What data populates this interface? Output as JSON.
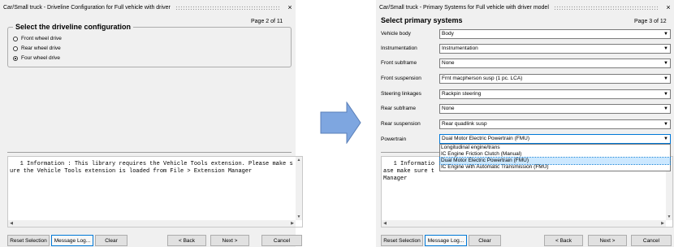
{
  "left_dialog": {
    "title": "Car/Small truck - Driveline Configuration for Full vehicle with driver",
    "page": "Page  2 of 11",
    "group_title": "Select the driveline configuration",
    "options": [
      {
        "label": "Front wheel drive",
        "selected": false
      },
      {
        "label": "Rear wheel drive",
        "selected": false
      },
      {
        "label": "Four wheel drive",
        "selected": true
      }
    ],
    "log_text": "   1 Information : This library requires the Vehicle Tools extension. Please make sure the Vehicle Tools extension is loaded from File > Extension Manager",
    "buttons": {
      "reset": "Reset Selection",
      "message_log": "Message Log...",
      "clear": "Clear",
      "back": "< Back",
      "next": "Next >",
      "cancel": "Cancel"
    }
  },
  "right_dialog": {
    "title": "Car/Small truck - Primary Systems for Full vehicle with driver model",
    "heading": "Select primary systems",
    "page": "Page  3 of 12",
    "rows": [
      {
        "label": "Vehicle body",
        "value": "Body"
      },
      {
        "label": "Instrumentation",
        "value": "Instrumentation"
      },
      {
        "label": "Front subframe",
        "value": "None"
      },
      {
        "label": "Front suspension",
        "value": "Frnt macpherson susp (1 pc. LCA)"
      },
      {
        "label": "Steering linkages",
        "value": "Rackpin steering"
      },
      {
        "label": "Rear subframe",
        "value": "None"
      },
      {
        "label": "Rear suspension",
        "value": "Rear quadlink susp"
      },
      {
        "label": "Powertrain",
        "value": "Dual Motor Electric Powertrain (FMU)"
      }
    ],
    "powertrain_options": [
      "Longitudinal engine/trans",
      "IC Engine Friction Clutch (Manual)",
      "Dual Motor Electric Powertrain (FMU)",
      "IC Engine with Automatic Transmission (FMU)"
    ],
    "log_text_visible": "   1 Informatio\nase make sure t\nManager",
    "buttons": {
      "reset": "Reset Selection",
      "message_log": "Message Log...",
      "clear": "Clear",
      "back": "< Back",
      "next": "Next >",
      "cancel": "Cancel"
    }
  },
  "icons": {
    "close": "×",
    "arrow_fill": "#7ea6e0",
    "arrow_stroke": "#5a7fb8"
  }
}
